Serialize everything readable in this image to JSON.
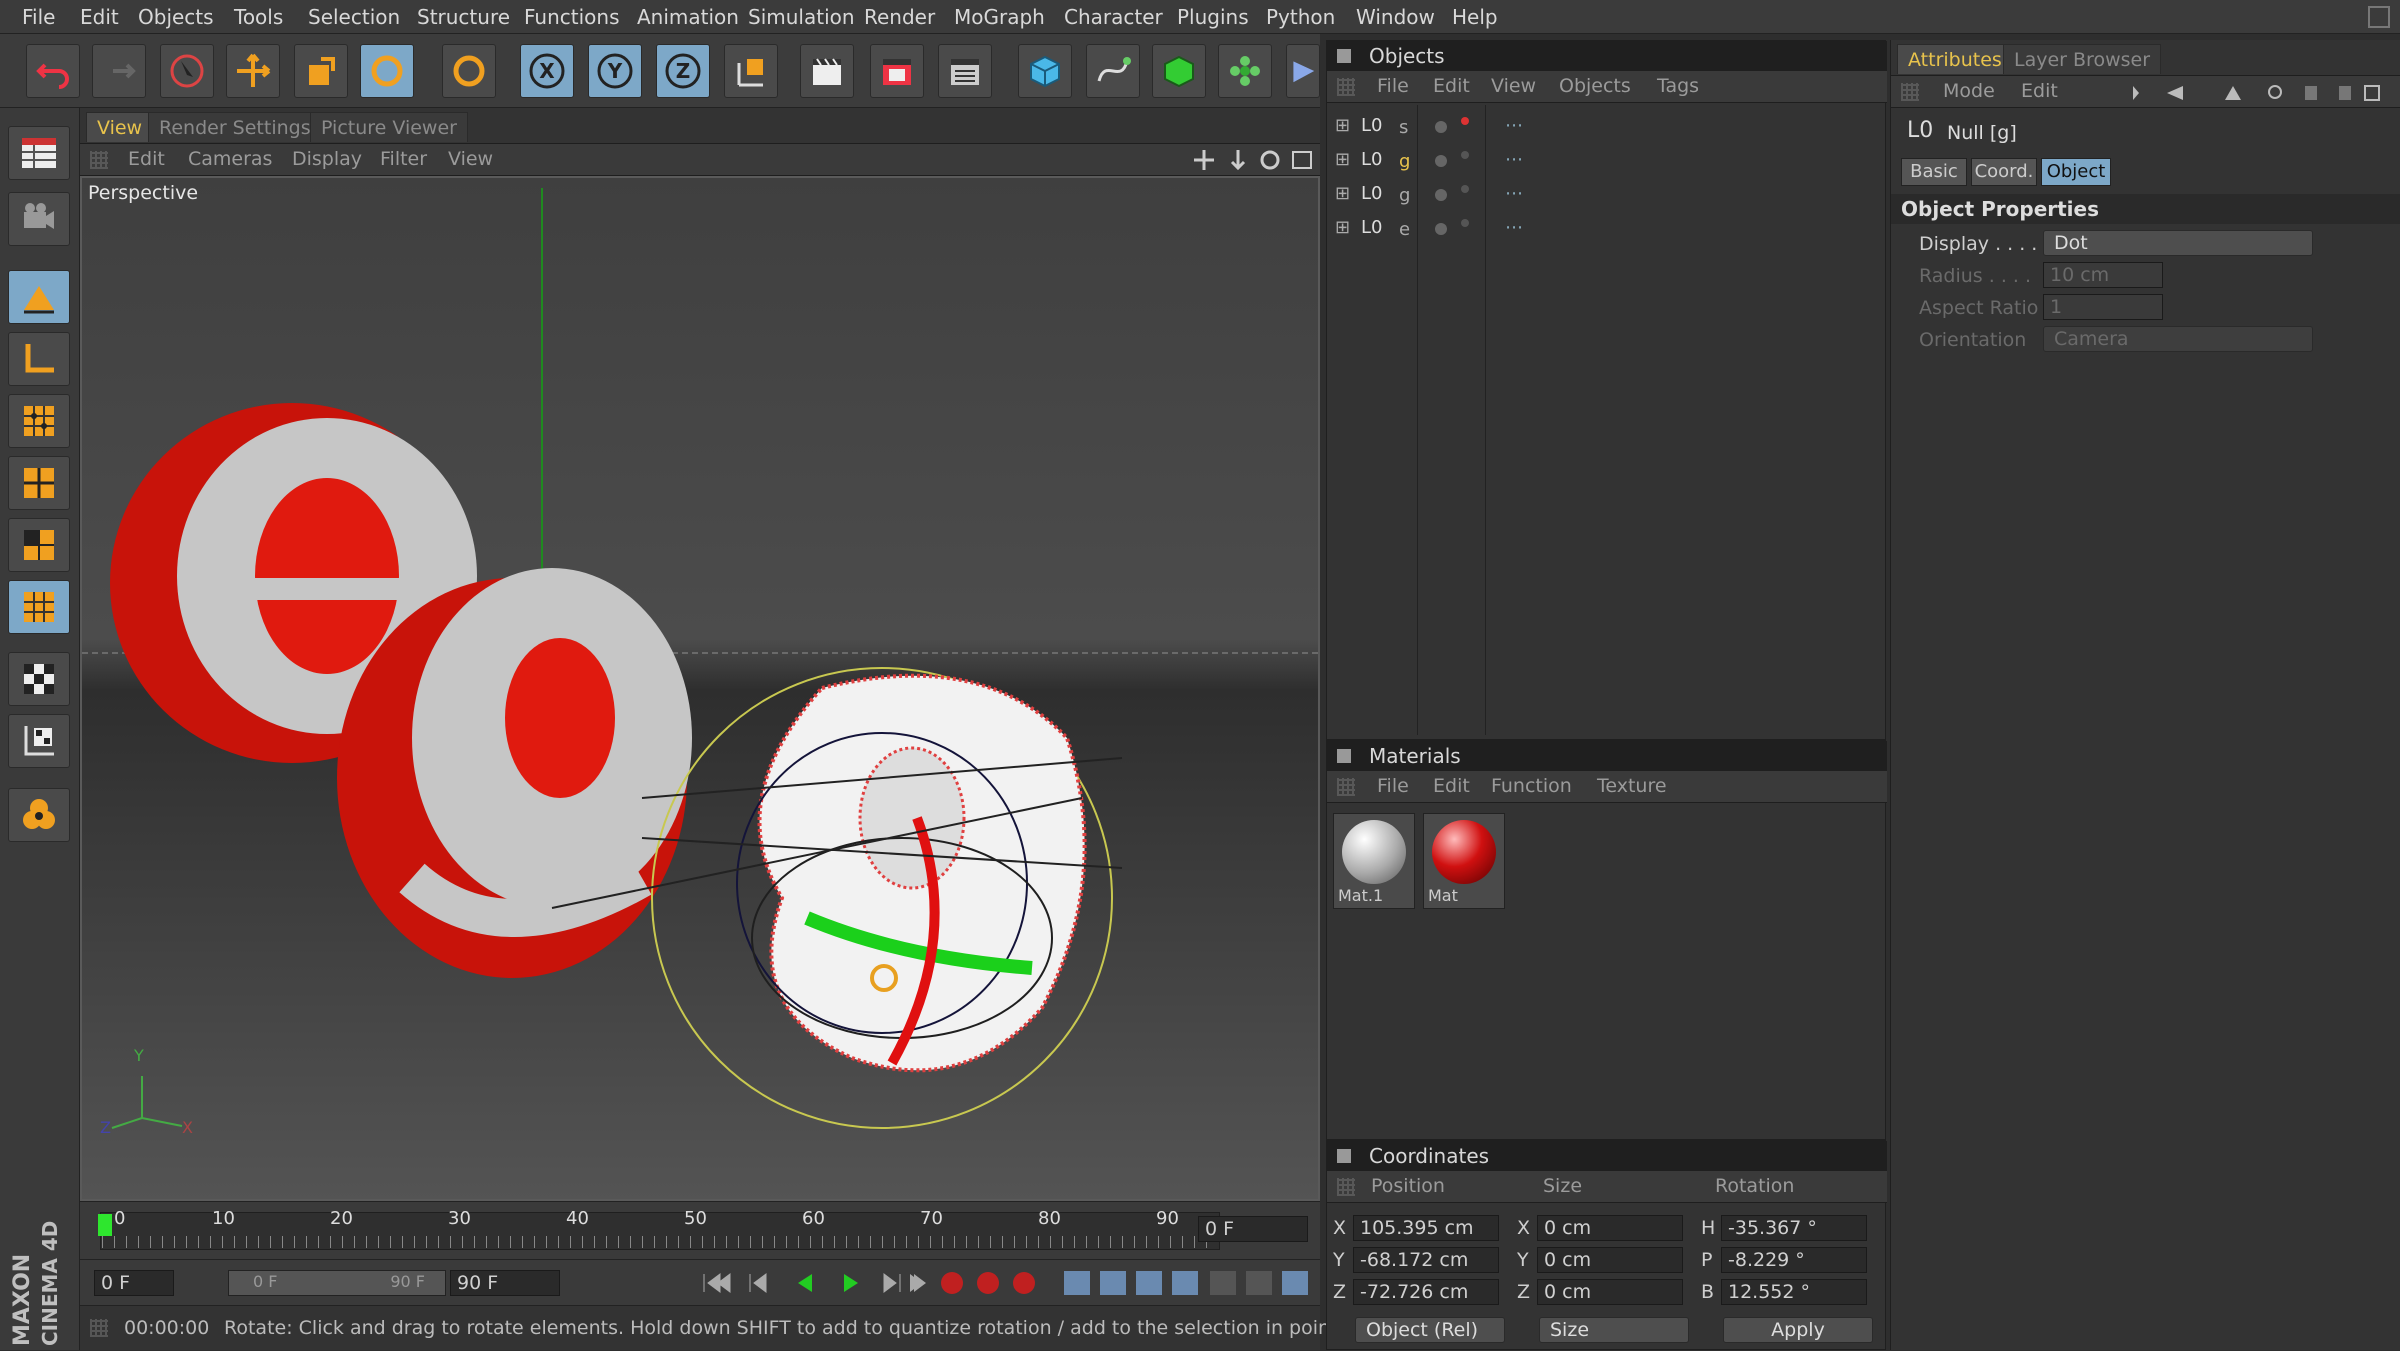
{
  "menu": [
    "File",
    "Edit",
    "Objects",
    "Tools",
    "Selection",
    "Structure",
    "Functions",
    "Animation",
    "Simulation",
    "Render",
    "MoGraph",
    "Character",
    "Plugins",
    "Python",
    "Window",
    "Help"
  ],
  "toolbar_icons": [
    "undo-icon",
    "redo-icon",
    "live-selection-icon",
    "move-icon",
    "scale-icon",
    "rotate-icon",
    "recent-tool-icon",
    "x-axis-lock-icon",
    "y-axis-lock-icon",
    "z-axis-lock-icon",
    "coordinate-system-icon",
    "render-view-icon",
    "render-picture-viewer-icon",
    "edit-render-settings-icon",
    "cube-primitive-icon",
    "spline-icon",
    "nurbs-icon",
    "array-icon",
    "deformer-icon"
  ],
  "left_icons": [
    "layout-icon",
    "camera-icon",
    "model-mode-icon",
    "object-axis-icon",
    "points-mode-icon",
    "edges-mode-icon",
    "polygons-mode-icon",
    "texture-mode-icon",
    "workplane-icon",
    "solo-icon",
    "render-icon"
  ],
  "viewport": {
    "tabs": [
      "View",
      "Render Settings",
      "Picture Viewer"
    ],
    "menu": [
      "Edit",
      "Cameras",
      "Display",
      "Filter",
      "View"
    ],
    "camera_label": "Perspective",
    "axis_labels": {
      "y": "Y",
      "z": "Z",
      "x": "X"
    }
  },
  "timeline": {
    "ticks": [
      "0",
      "10",
      "20",
      "30",
      "40",
      "50",
      "60",
      "70",
      "80",
      "90"
    ],
    "current_frame": "0 F",
    "start_frame": "0 F",
    "range_start": "0 F",
    "range_end": "90 F",
    "end_frame": "90 F"
  },
  "status": {
    "time": "00:00:00",
    "message": "Rotate: Click and drag to rotate elements. Hold down SHIFT to add to quantize rotation / add to the selection in point mode,"
  },
  "brand": {
    "line1": "MAXON",
    "line2": "CINEMA 4D"
  },
  "objects_panel": {
    "title": "Objects",
    "menu": [
      "File",
      "Edit",
      "View",
      "Objects",
      "Tags"
    ],
    "items": [
      {
        "name": "s",
        "color": "#aaaaaa"
      },
      {
        "name": "g",
        "color": "#e8c34c"
      },
      {
        "name": "g",
        "color": "#aaaaaa"
      },
      {
        "name": "e",
        "color": "#aaaaaa"
      }
    ]
  },
  "materials_panel": {
    "title": "Materials",
    "menu": [
      "File",
      "Edit",
      "Function",
      "Texture"
    ],
    "items": [
      {
        "name": "Mat.1",
        "color": "#e0e0e0"
      },
      {
        "name": "Mat",
        "color": "#d01010"
      }
    ]
  },
  "coordinates_panel": {
    "title": "Coordinates",
    "headers": [
      "Position",
      "Size",
      "Rotation"
    ],
    "rows": [
      {
        "axis": "X",
        "pos": "105.395 cm",
        "size_axis": "X",
        "size": "0 cm",
        "rot_axis": "H",
        "rot": "-35.367 °"
      },
      {
        "axis": "Y",
        "pos": "-68.172 cm",
        "size_axis": "Y",
        "size": "0 cm",
        "rot_axis": "P",
        "rot": "-8.229 °"
      },
      {
        "axis": "Z",
        "pos": "-72.726 cm",
        "size_axis": "Z",
        "size": "0 cm",
        "rot_axis": "B",
        "rot": "12.552 °"
      }
    ],
    "mode_dropdown": "Object (Rel)",
    "size_dropdown": "Size",
    "apply_label": "Apply"
  },
  "attributes_panel": {
    "tabs": [
      "Attributes",
      "Layer Browser"
    ],
    "menu": [
      "Mode",
      "Edit"
    ],
    "object_title": "Null [g]",
    "subtabs": [
      "Basic",
      "Coord.",
      "Object"
    ],
    "section_title": "Object Properties",
    "display_label": "Display . . . .",
    "display_value": "Dot",
    "radius_label": "Radius . . . .",
    "radius_value": "10 cm",
    "aspect_label": "Aspect Ratio",
    "aspect_value": "1",
    "orientation_label": "Orientation",
    "orientation_value": "Camera"
  },
  "colors": {
    "accent": "#e8c34c",
    "selected_tab": "#7da8c8",
    "egg_red": "#d81c10",
    "egg_face": "#c9c9c9"
  }
}
